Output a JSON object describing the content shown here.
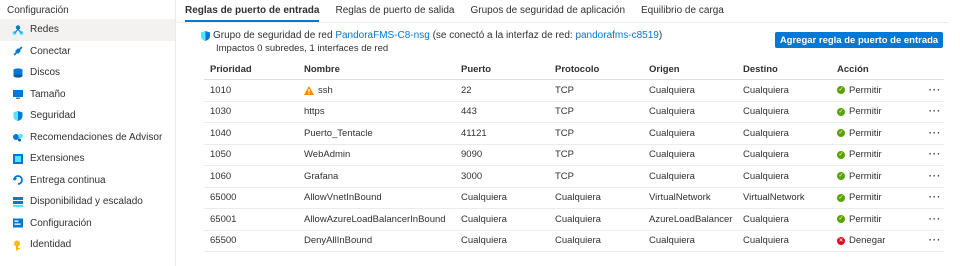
{
  "sidebar": {
    "header": "Configuración",
    "items": [
      {
        "label": "Redes",
        "icon": "network-icon"
      },
      {
        "label": "Conectar",
        "icon": "connect-icon"
      },
      {
        "label": "Discos",
        "icon": "disks-icon"
      },
      {
        "label": "Tamaño",
        "icon": "size-icon"
      },
      {
        "label": "Seguridad",
        "icon": "shield-icon"
      },
      {
        "label": "Recomendaciones de Advisor",
        "icon": "advisor-icon"
      },
      {
        "label": "Extensiones",
        "icon": "extensions-icon"
      },
      {
        "label": "Entrega continua",
        "icon": "continuous-delivery-icon"
      },
      {
        "label": "Disponibilidad y escalado",
        "icon": "availability-icon"
      },
      {
        "label": "Configuración",
        "icon": "configuration-icon"
      },
      {
        "label": "Identidad",
        "icon": "identity-icon"
      }
    ]
  },
  "tabs": [
    {
      "label": "Reglas de puerto de entrada"
    },
    {
      "label": "Reglas de puerto de salida"
    },
    {
      "label": "Grupos de seguridad de aplicación"
    },
    {
      "label": "Equilibrio de carga"
    }
  ],
  "nsg": {
    "prefix": "Grupo de seguridad de red",
    "name": "PandoraFMS-C8-nsg",
    "middle": "(se conectó a la interfaz de red:",
    "nic": "pandorafms-c8519",
    "suffix": ")",
    "impacts": "Impactos 0 subredes, 1 interfaces de red"
  },
  "add_button_label": "Agregar regla de puerto de entrada",
  "table": {
    "headers": {
      "priority": "Prioridad",
      "name": "Nombre",
      "port": "Puerto",
      "protocol": "Protocolo",
      "source": "Origen",
      "destination": "Destino",
      "action": "Acción"
    },
    "more_label": "···",
    "rows": [
      {
        "priority": "1010",
        "name": "ssh",
        "port": "22",
        "protocol": "TCP",
        "source": "Cualquiera",
        "destination": "Cualquiera",
        "action": "Permitir",
        "warning": true
      },
      {
        "priority": "1030",
        "name": "https",
        "port": "443",
        "protocol": "TCP",
        "source": "Cualquiera",
        "destination": "Cualquiera",
        "action": "Permitir"
      },
      {
        "priority": "1040",
        "name": "Puerto_Tentacle",
        "port": "41121",
        "protocol": "TCP",
        "source": "Cualquiera",
        "destination": "Cualquiera",
        "action": "Permitir"
      },
      {
        "priority": "1050",
        "name": "WebAdmin",
        "port": "9090",
        "protocol": "TCP",
        "source": "Cualquiera",
        "destination": "Cualquiera",
        "action": "Permitir"
      },
      {
        "priority": "1060",
        "name": "Grafana",
        "port": "3000",
        "protocol": "TCP",
        "source": "Cualquiera",
        "destination": "Cualquiera",
        "action": "Permitir"
      },
      {
        "priority": "65000",
        "name": "AllowVnetInBound",
        "port": "Cualquiera",
        "protocol": "Cualquiera",
        "source": "VirtualNetwork",
        "destination": "VirtualNetwork",
        "action": "Permitir"
      },
      {
        "priority": "65001",
        "name": "AllowAzureLoadBalancerInBound",
        "port": "Cualquiera",
        "protocol": "Cualquiera",
        "source": "AzureLoadBalancer",
        "destination": "Cualquiera",
        "action": "Permitir"
      },
      {
        "priority": "65500",
        "name": "DenyAllInBound",
        "port": "Cualquiera",
        "protocol": "Cualquiera",
        "source": "Cualquiera",
        "destination": "Cualquiera",
        "action": "Denegar"
      }
    ]
  },
  "colors": {
    "accent": "#0078d4",
    "allow": "#57a300",
    "deny": "#e00b1c",
    "warning": "#ff8c00"
  }
}
